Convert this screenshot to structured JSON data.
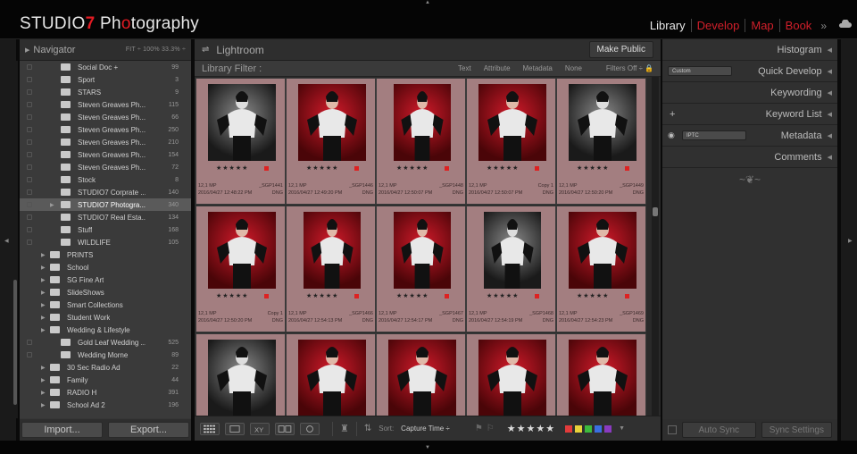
{
  "app": {
    "brand_prefix": "STUDIO",
    "brand_seven": "7",
    "brand_rest_a": " Ph",
    "brand_o": "o",
    "brand_rest_b": "tography"
  },
  "modules": [
    {
      "label": "Library",
      "state": "active"
    },
    {
      "label": "Develop",
      "state": "inactive"
    },
    {
      "label": "Map",
      "state": "inactive"
    },
    {
      "label": "Book",
      "state": "inactive"
    }
  ],
  "modules_more": "»",
  "navigator": {
    "title": "Navigator",
    "zoom": "FIT ÷   100%   33.3% ÷"
  },
  "tree": [
    {
      "label": "Social Doc +",
      "count": "99",
      "level": 2,
      "sel": false
    },
    {
      "label": "Sport",
      "count": "3",
      "level": 2,
      "sel": false
    },
    {
      "label": "STARS",
      "count": "9",
      "level": 2,
      "sel": false
    },
    {
      "label": "Steven Greaves Ph...",
      "count": "115",
      "level": 2,
      "sel": false
    },
    {
      "label": "Steven Greaves Ph...",
      "count": "66",
      "level": 2,
      "sel": false
    },
    {
      "label": "Steven Greaves Ph...",
      "count": "250",
      "level": 2,
      "sel": false
    },
    {
      "label": "Steven Greaves Ph...",
      "count": "210",
      "level": 2,
      "sel": false
    },
    {
      "label": "Steven Greaves Ph...",
      "count": "154",
      "level": 2,
      "sel": false
    },
    {
      "label": "Steven Greaves Ph...",
      "count": "72",
      "level": 2,
      "sel": false
    },
    {
      "label": "Stock",
      "count": "8",
      "level": 2,
      "sel": false
    },
    {
      "label": "STUDIO7 Corprate ...",
      "count": "140",
      "level": 2,
      "sel": false
    },
    {
      "label": "STUDIO7 Photogra...",
      "count": "340",
      "level": 2,
      "sel": true
    },
    {
      "label": "STUDIO7 Real Esta...",
      "count": "134",
      "level": 2,
      "sel": false
    },
    {
      "label": "Stuff",
      "count": "168",
      "level": 2,
      "sel": false
    },
    {
      "label": "WILDLIFE",
      "count": "105",
      "level": 2,
      "sel": false
    },
    {
      "label": "PRINTS",
      "count": "",
      "level": 1,
      "sel": false
    },
    {
      "label": "School",
      "count": "",
      "level": 1,
      "sel": false
    },
    {
      "label": "SG Fine Art",
      "count": "",
      "level": 1,
      "sel": false
    },
    {
      "label": "SlideShows",
      "count": "",
      "level": 1,
      "sel": false
    },
    {
      "label": "Smart Collections",
      "count": "",
      "level": 1,
      "sel": false
    },
    {
      "label": "Student Work",
      "count": "",
      "level": 1,
      "sel": false
    },
    {
      "label": "Wedding & Lifestyle",
      "count": "",
      "level": 1,
      "sel": false
    },
    {
      "label": "Gold Leaf Wedding ...",
      "count": "525",
      "level": 2,
      "sel": false
    },
    {
      "label": "Wedding Morne",
      "count": "89",
      "level": 2,
      "sel": false
    },
    {
      "label": "30 Sec Radio Ad",
      "count": "22",
      "level": 1,
      "sel": false
    },
    {
      "label": "Family",
      "count": "44",
      "level": 1,
      "sel": false
    },
    {
      "label": "RADIO H",
      "count": "391",
      "level": 1,
      "sel": false
    },
    {
      "label": "School Ad 2",
      "count": "196",
      "level": 1,
      "sel": false
    }
  ],
  "left_buttons": {
    "import": "Import...",
    "export": "Export..."
  },
  "center": {
    "title": "Lightroom",
    "make_public": "Make Public"
  },
  "filter": {
    "title": "Library Filter :",
    "opts": [
      "Text",
      "Attribute",
      "Metadata",
      "None"
    ],
    "off": "Filters Off ÷"
  },
  "cells": [
    {
      "bg": "bw",
      "mp": "12,1 MP",
      "name": "_SGP1441",
      "date": "2016/04/27 12:48:22 PM",
      "fmt": "DNG"
    },
    {
      "bg": "red",
      "mp": "12,1 MP",
      "name": "_SGP1446",
      "date": "2016/04/27 12:49:20 PM",
      "fmt": "DNG"
    },
    {
      "bg": "red",
      "mp": "12,1 MP",
      "name": "_SGP1448",
      "date": "2016/04/27 12:50:07 PM",
      "fmt": "DNG"
    },
    {
      "bg": "red",
      "mp": "12,1 MP",
      "name": "Copy 1",
      "date": "2016/04/27 12:50:07 PM",
      "fmt": "DNG"
    },
    {
      "bg": "bw",
      "mp": "12,1 MP",
      "name": "_SGP1449",
      "date": "2016/04/27 12:50:20 PM",
      "fmt": "DNG"
    },
    {
      "bg": "red",
      "mp": "12,1 MP",
      "name": "Copy 1",
      "date": "2016/04/27 12:50:20 PM",
      "fmt": "DNG"
    },
    {
      "bg": "red",
      "mp": "12,1 MP",
      "name": "_SGP1466",
      "date": "2016/04/27 12:54:13 PM",
      "fmt": "DNG"
    },
    {
      "bg": "red",
      "mp": "12,1 MP",
      "name": "_SGP1467",
      "date": "2016/04/27 12:54:17 PM",
      "fmt": "DNG"
    },
    {
      "bg": "bw",
      "mp": "12,1 MP",
      "name": "_SGP1468",
      "date": "2016/04/27 12:54:19 PM",
      "fmt": "DNG"
    },
    {
      "bg": "red",
      "mp": "12,1 MP",
      "name": "_SGP1469",
      "date": "2016/04/27 12:54:23 PM",
      "fmt": "DNG"
    },
    {
      "bg": "bw",
      "mp": "",
      "name": "",
      "date": "",
      "fmt": ""
    },
    {
      "bg": "red",
      "mp": "",
      "name": "",
      "date": "",
      "fmt": ""
    },
    {
      "bg": "red",
      "mp": "",
      "name": "",
      "date": "",
      "fmt": ""
    },
    {
      "bg": "red",
      "mp": "",
      "name": "",
      "date": "",
      "fmt": ""
    },
    {
      "bg": "red",
      "mp": "",
      "name": "",
      "date": "",
      "fmt": ""
    }
  ],
  "stars": "★★★★★",
  "toolbar": {
    "sort_label": "Sort:",
    "sort_value": "Capture Time ÷",
    "stars": "★★★★★",
    "swatches": [
      "#e23b3b",
      "#e8d23a",
      "#3dbb3d",
      "#3a6fe0",
      "#8a3ac0"
    ]
  },
  "right": {
    "panels": [
      "Histogram",
      "Quick Develop",
      "Keywording",
      "Keyword List",
      "Metadata",
      "Comments"
    ],
    "quick_preset": "Custom",
    "meta_preset": "IPTC",
    "ornament": "~❦~",
    "sync": "Auto Sync",
    "sync_settings": "Sync Settings"
  }
}
